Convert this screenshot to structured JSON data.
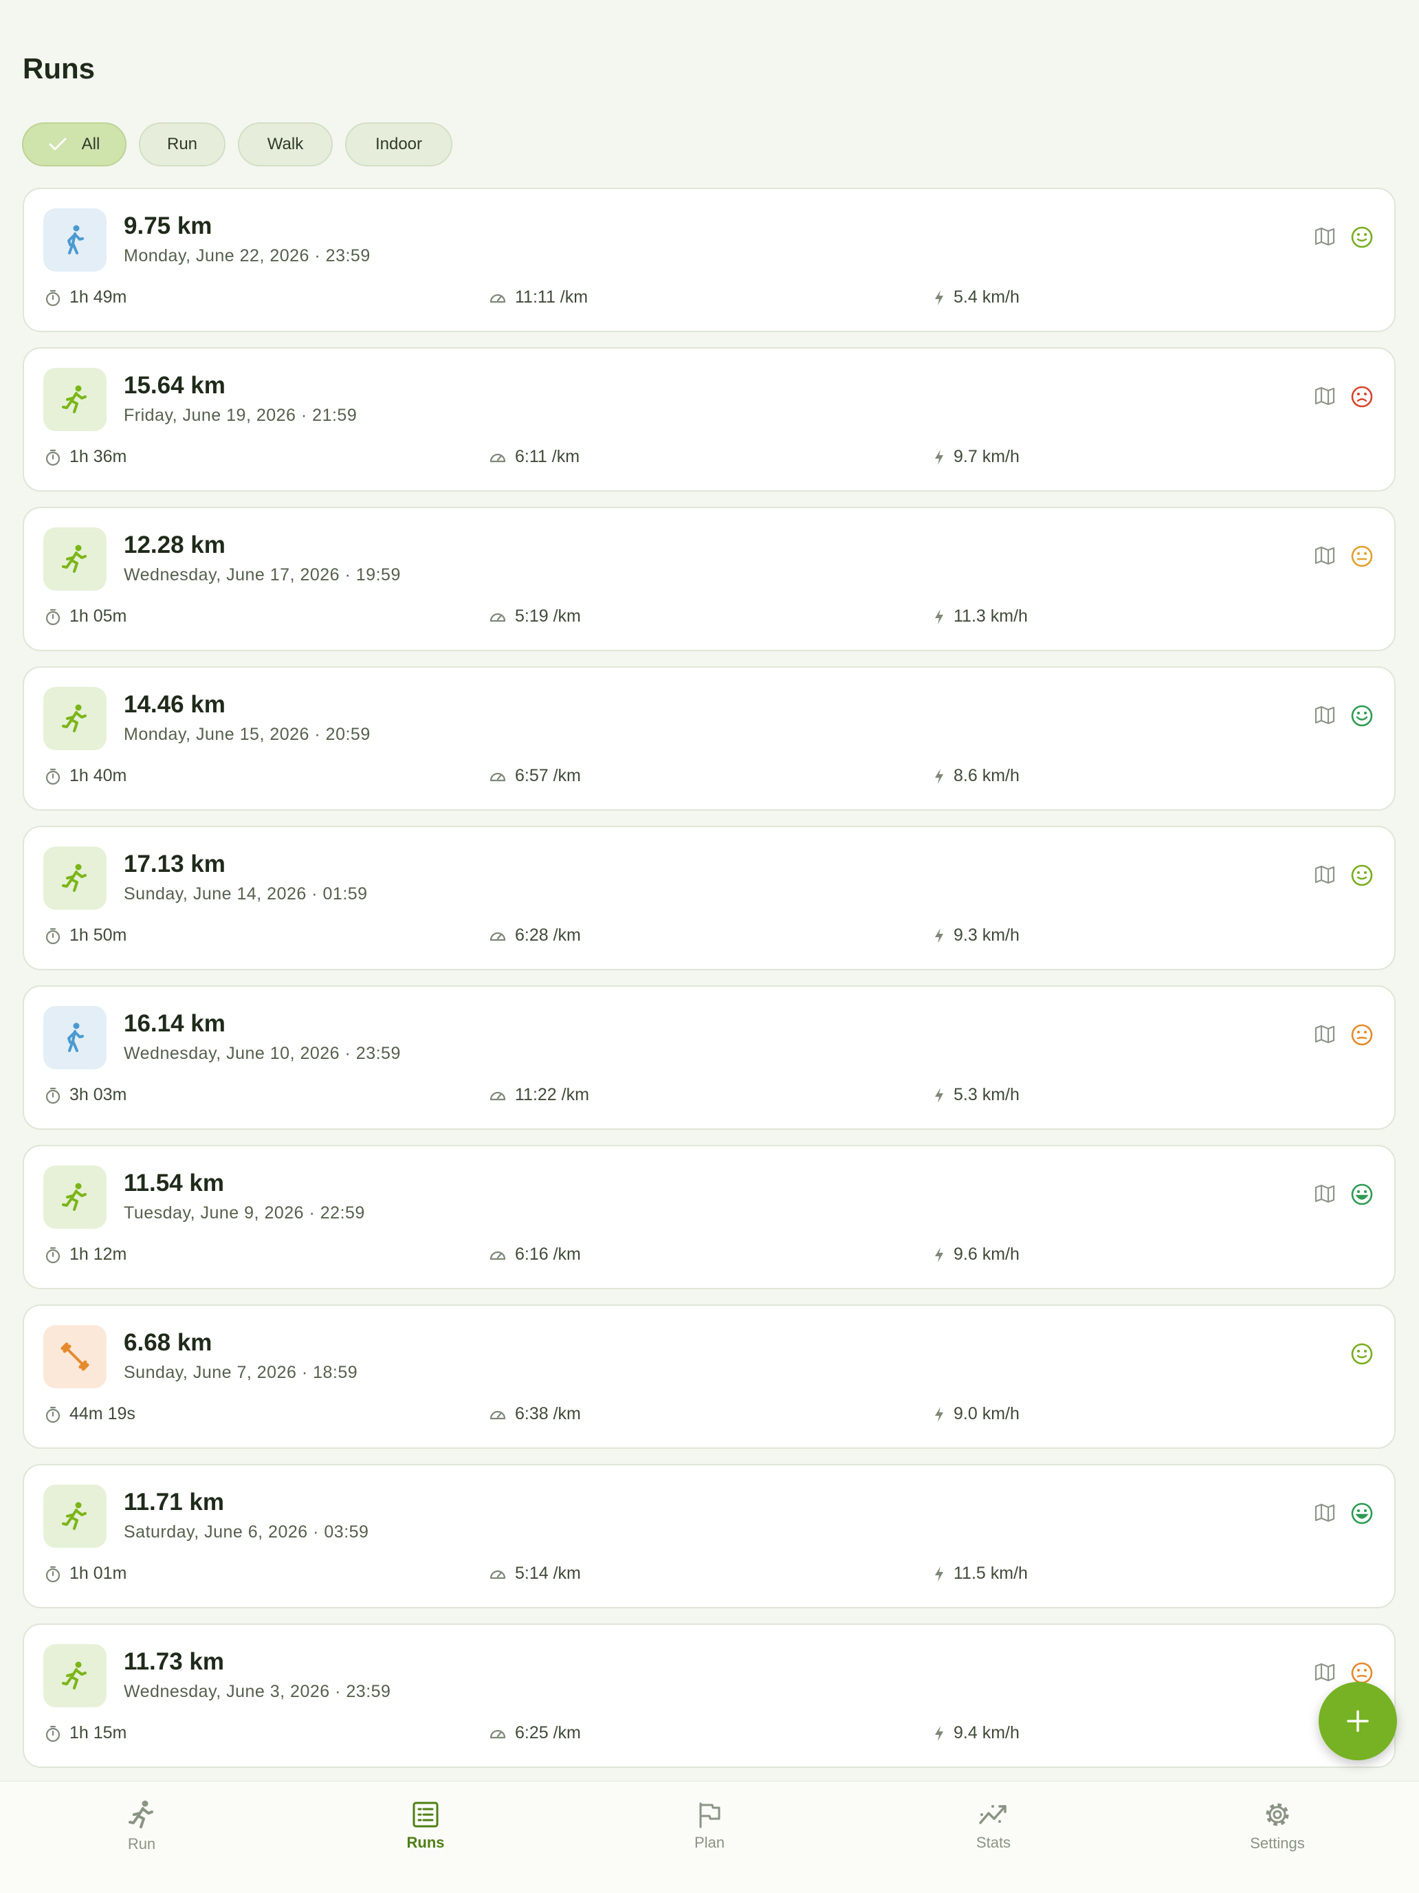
{
  "page": {
    "title": "Runs"
  },
  "filters": [
    {
      "label": "All",
      "active": true
    },
    {
      "label": "Run",
      "active": false
    },
    {
      "label": "Walk",
      "active": false
    },
    {
      "label": "Indoor",
      "active": false
    }
  ],
  "colors": {
    "accent": "#76b223",
    "run": "#7cb518",
    "walk": "#4a9ad0",
    "gym": "#e58a2c",
    "mood_content": "#78ad1f",
    "mood_sad": "#d9442e",
    "mood_neutral": "#e2a02c",
    "mood_happy": "#2e9b52",
    "mood_meh": "#e58a2c"
  },
  "runs": [
    {
      "distance": "9.75 km",
      "date": "Monday, June 22, 2026 · 23:59",
      "duration": "1h 49m",
      "pace": "11:11 /km",
      "speed": "5.4 km/h",
      "type": "walk",
      "mood": "content",
      "has_map": true
    },
    {
      "distance": "15.64 km",
      "date": "Friday, June 19, 2026 · 21:59",
      "duration": "1h 36m",
      "pace": "6:11 /km",
      "speed": "9.7 km/h",
      "type": "run",
      "mood": "sad",
      "has_map": true
    },
    {
      "distance": "12.28 km",
      "date": "Wednesday, June 17, 2026 · 19:59",
      "duration": "1h 05m",
      "pace": "5:19 /km",
      "speed": "11.3 km/h",
      "type": "run",
      "mood": "neutral",
      "has_map": true
    },
    {
      "distance": "14.46 km",
      "date": "Monday, June 15, 2026 · 20:59",
      "duration": "1h 40m",
      "pace": "6:57 /km",
      "speed": "8.6 km/h",
      "type": "run",
      "mood": "happy",
      "has_map": true
    },
    {
      "distance": "17.13 km",
      "date": "Sunday, June 14, 2026 · 01:59",
      "duration": "1h 50m",
      "pace": "6:28 /km",
      "speed": "9.3 km/h",
      "type": "run",
      "mood": "content",
      "has_map": true
    },
    {
      "distance": "16.14 km",
      "date": "Wednesday, June 10, 2026 · 23:59",
      "duration": "3h 03m",
      "pace": "11:22 /km",
      "speed": "5.3 km/h",
      "type": "walk",
      "mood": "meh",
      "has_map": true
    },
    {
      "distance": "11.54 km",
      "date": "Tuesday, June 9, 2026 · 22:59",
      "duration": "1h 12m",
      "pace": "6:16 /km",
      "speed": "9.6 km/h",
      "type": "run",
      "mood": "great",
      "has_map": true
    },
    {
      "distance": "6.68 km",
      "date": "Sunday, June 7, 2026 · 18:59",
      "duration": "44m 19s",
      "pace": "6:38 /km",
      "speed": "9.0 km/h",
      "type": "gym",
      "mood": "content",
      "has_map": false
    },
    {
      "distance": "11.71 km",
      "date": "Saturday, June 6, 2026 · 03:59",
      "duration": "1h 01m",
      "pace": "5:14 /km",
      "speed": "11.5 km/h",
      "type": "run",
      "mood": "great",
      "has_map": true
    },
    {
      "distance": "11.73 km",
      "date": "Wednesday, June 3, 2026 · 23:59",
      "duration": "1h 15m",
      "pace": "6:25 /km",
      "speed": "9.4 km/h",
      "type": "run",
      "mood": "meh",
      "has_map": true
    }
  ],
  "fab": {
    "icon": "plus-icon"
  },
  "nav": [
    {
      "label": "Run",
      "icon": "runner-icon",
      "active": false
    },
    {
      "label": "Runs",
      "icon": "list-icon",
      "active": true
    },
    {
      "label": "Plan",
      "icon": "flag-icon",
      "active": false
    },
    {
      "label": "Stats",
      "icon": "chart-icon",
      "active": false
    },
    {
      "label": "Settings",
      "icon": "gear-icon",
      "active": false
    }
  ]
}
